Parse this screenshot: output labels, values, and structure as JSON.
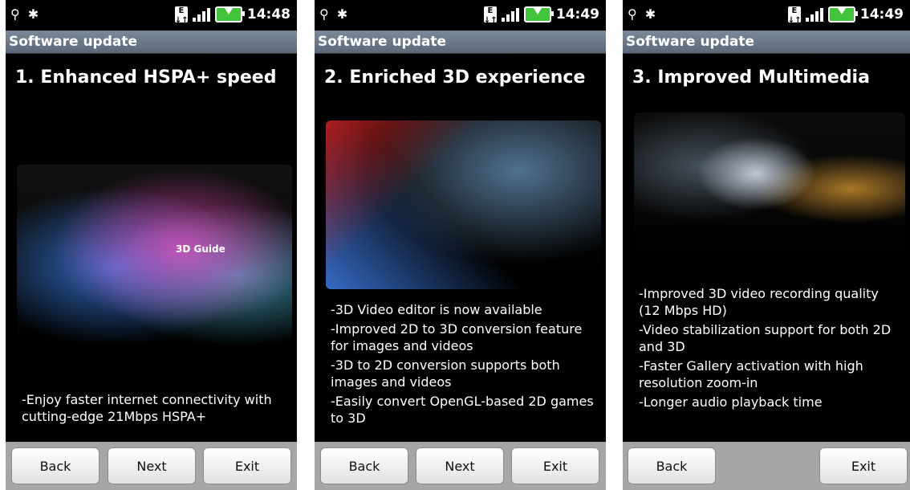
{
  "screens": [
    {
      "status": {
        "time": "14:48"
      },
      "title": "Software update",
      "heading": "1. Enhanced HSPA+ speed",
      "image_label": "3D Guide",
      "bullets": [
        "-Enjoy faster internet connectivity with cutting-edge 21Mbps HSPA+"
      ],
      "buttons": {
        "back": "Back",
        "next": "Next",
        "exit": "Exit"
      }
    },
    {
      "status": {
        "time": "14:49"
      },
      "title": "Software update",
      "heading": "2. Enriched 3D experience",
      "bullets": [
        "-3D Video editor is now available",
        "-Improved 2D to 3D conversion feature for images and videos",
        "-3D to 2D conversion supports both images and videos",
        "-Easily convert OpenGL-based 2D games to 3D"
      ],
      "buttons": {
        "back": "Back",
        "next": "Next",
        "exit": "Exit"
      }
    },
    {
      "status": {
        "time": "14:49"
      },
      "title": "Software update",
      "heading": "3. Improved Multimedia",
      "bullets": [
        "-Improved 3D video recording quality (12 Mbps HD)",
        "-Video stabilization support for both 2D and 3D",
        "-Faster Gallery activation with high resolution zoom-in",
        "-Longer audio playback time"
      ],
      "buttons": {
        "back": "Back",
        "exit": "Exit"
      }
    }
  ],
  "colors": {
    "titlebar": "#6c7a8a",
    "battery": "#43c33b",
    "bottombar": "#a6a6a6"
  },
  "icons": [
    "usb-icon",
    "android-debug-icon",
    "edge-network-icon",
    "signal-icon",
    "battery-charging-icon"
  ]
}
